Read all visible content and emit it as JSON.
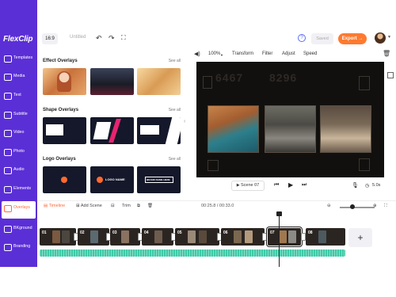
{
  "app": {
    "logo": "FlexClip"
  },
  "sidebar": {
    "items": [
      {
        "label": "Templates",
        "icon": "templates-icon"
      },
      {
        "label": "Media",
        "icon": "media-icon"
      },
      {
        "label": "Text",
        "icon": "text-icon"
      },
      {
        "label": "Subtitle",
        "icon": "subtitle-icon"
      },
      {
        "label": "Video",
        "icon": "video-icon"
      },
      {
        "label": "Photo",
        "icon": "photo-icon"
      },
      {
        "label": "Audio",
        "icon": "audio-icon"
      },
      {
        "label": "Elements",
        "icon": "elements-icon"
      },
      {
        "label": "Overlays",
        "icon": "overlays-icon",
        "active": true
      },
      {
        "label": "BKground",
        "icon": "background-icon"
      },
      {
        "label": "Branding",
        "icon": "branding-icon"
      }
    ]
  },
  "topbar": {
    "ratio": "16:9",
    "project_name": "Untitled",
    "saved_label": "Saved",
    "export_label": "Export →"
  },
  "library": {
    "sections": [
      {
        "title": "Effect Overlays",
        "see_all": "See all"
      },
      {
        "title": "Shape Overlays",
        "see_all": "See all"
      },
      {
        "title": "Logo Overlays",
        "see_all": "See all"
      }
    ],
    "logo_thumb_texts": [
      "LOGO NAME",
      "BRAND NAME HERE"
    ]
  },
  "preview": {
    "zoom": "100%",
    "toolbar": [
      "Transform",
      "Filter",
      "Adjust",
      "Speed"
    ],
    "scene_label": "Scene 07",
    "duration": "5.0s",
    "film_numbers": [
      "6467",
      "8296"
    ]
  },
  "timeline": {
    "toolbar": {
      "timeline": "Timeline",
      "add_scene": "Add Scene",
      "trim": "Trim"
    },
    "timecode": "00:25.8 / 00:33.0",
    "clips": [
      "01",
      "02",
      "03",
      "04",
      "05",
      "06",
      "07",
      "08"
    ],
    "selected_clip": "07"
  },
  "colors": {
    "sidebar": "#5b2fd6",
    "accent": "#ff7a2f",
    "audio": "#3ec9a6"
  }
}
